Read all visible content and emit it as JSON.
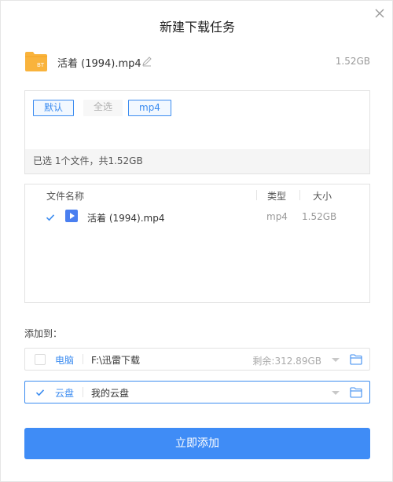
{
  "dialog": {
    "title": "新建下载任务"
  },
  "file_header": {
    "icon": "bt-folder-icon",
    "icon_badge": "BT",
    "name": "活着 (1994).mp4",
    "size": "1.52GB"
  },
  "filter": {
    "chips": [
      {
        "label": "默认",
        "active": true
      },
      {
        "label": "全选",
        "active": false
      },
      {
        "label": "mp4",
        "active": true
      }
    ],
    "status": "已选 1个文件，共1.52GB"
  },
  "table": {
    "headers": {
      "name": "文件名称",
      "type": "类型",
      "size": "大小"
    },
    "rows": [
      {
        "checked": true,
        "icon": "video-play-icon",
        "name": "活着 (1994).mp4",
        "type": "mp4",
        "size": "1.52GB"
      }
    ]
  },
  "add_to": {
    "label": "添加到："
  },
  "destinations": {
    "pc": {
      "label": "电脑",
      "path": "F:\\迅雷下载",
      "free": "剩余:312.89GB",
      "checked": false
    },
    "cloud": {
      "label": "云盘",
      "path": "我的云盘",
      "checked": true
    }
  },
  "submit": {
    "label": "立即添加"
  },
  "colors": {
    "accent": "#3c8cf0",
    "button": "#3f8cf6",
    "folder": "#f9b33c",
    "video": "#4a7ff0"
  }
}
